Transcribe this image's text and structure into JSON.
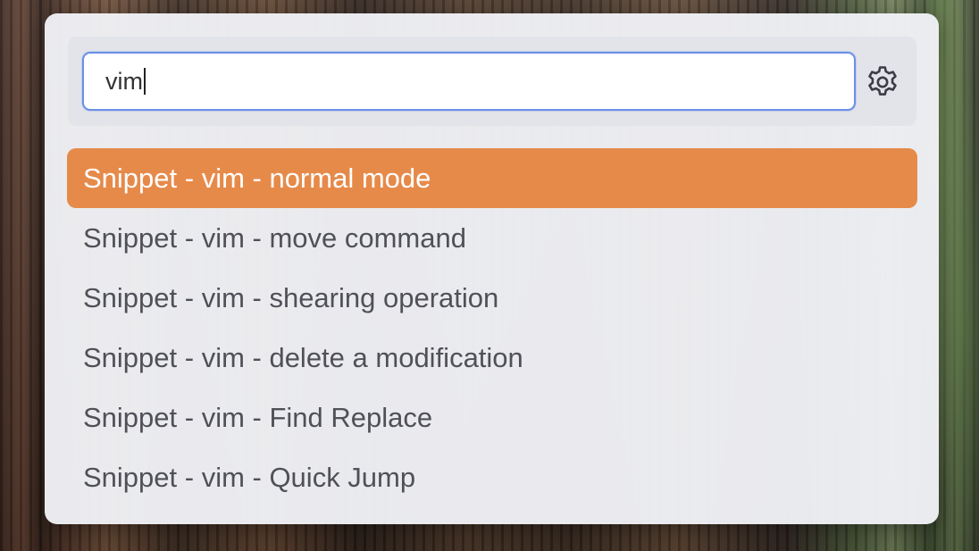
{
  "search": {
    "value": "vim"
  },
  "settings_icon": "gear-icon",
  "results": [
    {
      "label": "Snippet - vim - normal mode",
      "selected": true
    },
    {
      "label": "Snippet - vim - move command",
      "selected": false
    },
    {
      "label": "Snippet - vim - shearing operation",
      "selected": false
    },
    {
      "label": "Snippet - vim - delete a modification",
      "selected": false
    },
    {
      "label": "Snippet - vim - Find Replace",
      "selected": false
    },
    {
      "label": "Snippet - vim - Quick Jump",
      "selected": false
    }
  ],
  "colors": {
    "selected_bg": "#e68a4a",
    "focus_ring": "#6d8fe6"
  }
}
